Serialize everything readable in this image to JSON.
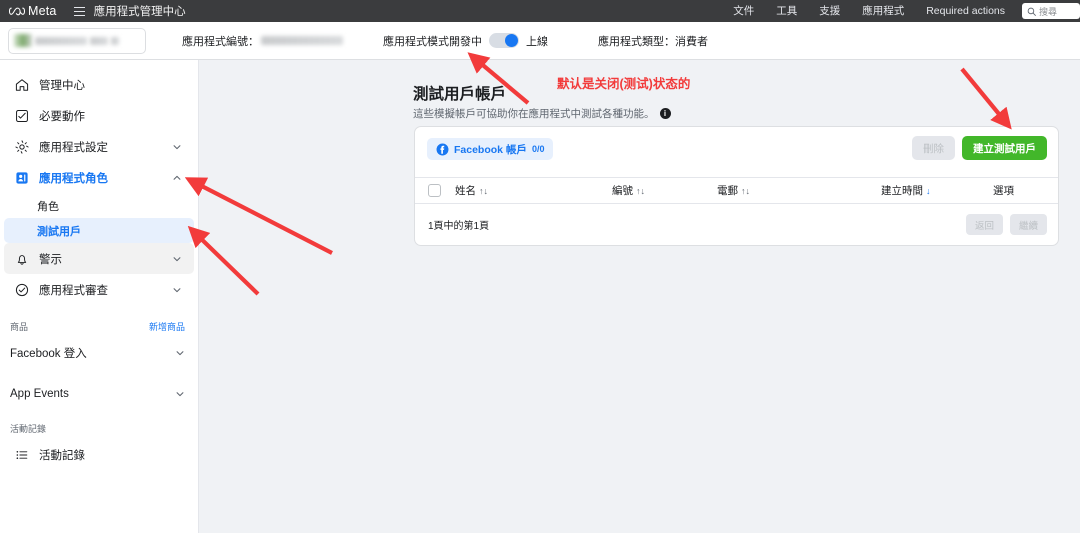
{
  "topbar": {
    "brand": "Meta",
    "menu_icon": "hamburger-icon",
    "title": "應用程式管理中心",
    "nav": [
      {
        "label": "文件"
      },
      {
        "label": "工具"
      },
      {
        "label": "支援"
      },
      {
        "label": "應用程式"
      },
      {
        "label": "Required actions"
      }
    ],
    "search": {
      "placeholder": "搜尋",
      "icon": "search-icon"
    }
  },
  "subbar": {
    "app_selector_value": "",
    "app_id_label": "應用程式編號：",
    "app_id_value": "",
    "app_mode_label": "應用程式模式開發中",
    "app_mode_toggle_state": "on",
    "app_mode_on_label": "上線",
    "app_type_label": "應用程式類型：",
    "app_type_value": "消費者"
  },
  "sidebar": {
    "items": [
      {
        "label": "管理中心",
        "icon": "home-icon",
        "expandable": false,
        "active": false
      },
      {
        "label": "必要動作",
        "icon": "checklist-icon",
        "expandable": false,
        "active": false
      },
      {
        "label": "應用程式設定",
        "icon": "gear-icon",
        "expandable": true,
        "active": false
      },
      {
        "label": "應用程式角色",
        "icon": "app-roles-icon",
        "expandable": true,
        "active": true
      }
    ],
    "sub_items": [
      {
        "label": "角色",
        "selected": false
      },
      {
        "label": "測試用戶",
        "selected": true
      }
    ],
    "items_after": [
      {
        "label": "警示",
        "icon": "bell-icon",
        "expandable": true,
        "active": false
      },
      {
        "label": "應用程式審查",
        "icon": "shield-check-icon",
        "expandable": true,
        "active": false
      }
    ],
    "products_section": {
      "title": "商品",
      "link": "新增商品"
    },
    "products": [
      {
        "label": "Facebook 登入",
        "expandable": true
      },
      {
        "label": "App Events",
        "expandable": true
      }
    ],
    "activity_section": {
      "title": "活動記錄"
    },
    "activity_items": [
      {
        "label": "活動記錄",
        "icon": "list-icon"
      }
    ]
  },
  "main": {
    "page_title": "測試用戶帳戶",
    "page_subtitle": "這些模擬帳戶可協助你在應用程式中測試各種功能。",
    "info_icon_glyph": "i",
    "card": {
      "tab": {
        "icon": "facebook-icon",
        "label": "Facebook 帳戶",
        "count": "0/0"
      },
      "delete_label": "刪除",
      "create_label": "建立測試用戶",
      "columns": [
        {
          "label": "姓名",
          "sort": "↑↓",
          "sorted": false
        },
        {
          "label": "編號",
          "sort": "↑↓",
          "sorted": false
        },
        {
          "label": "電郵",
          "sort": "↑↓",
          "sorted": false
        },
        {
          "label": "建立時間",
          "sort": "↓",
          "sorted": true
        },
        {
          "label": "選項",
          "sort": "",
          "sorted": false
        }
      ],
      "rows": [],
      "pagination_text": "1頁中的第1頁",
      "prev_label": "返回",
      "next_label": "繼續"
    }
  },
  "annotations": {
    "note_text": "默认是关闭(测试)状态的",
    "color": "#f23b3b"
  }
}
